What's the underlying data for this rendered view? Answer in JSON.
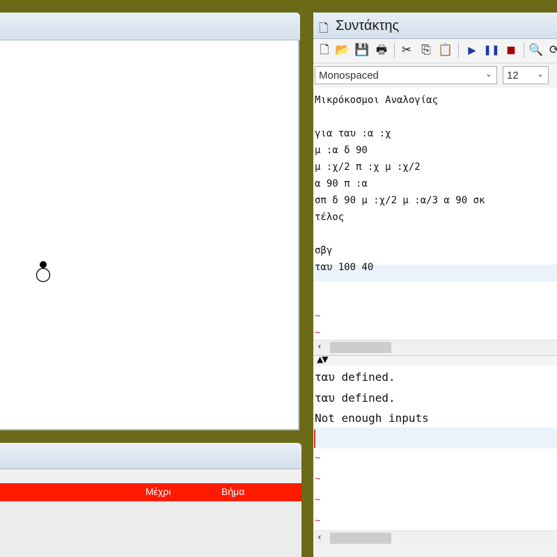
{
  "editor": {
    "title": "Συντάκτης",
    "font_select": {
      "value": "Monospaced"
    },
    "size_select": {
      "value": "12"
    },
    "code_lines": [
      "Μικρόκοσμοι Αναλογίας",
      "",
      "για ταυ :α :χ",
      "μ :α δ 90",
      "μ :χ/2 π :χ μ :χ/2",
      "α 90 π :α",
      "σπ δ 90 μ :χ/2 μ :α/3 α 90 σκ",
      "τέλος",
      "",
      "σβγ",
      "ταυ 100 40"
    ],
    "tilde": "~"
  },
  "console": {
    "lines": [
      "ταυ defined.",
      "ταυ defined.",
      "Not enough inputs"
    ]
  },
  "bottom_panel": {
    "columns": {
      "until": "Μέχρι",
      "step": "Βήμα"
    }
  },
  "colors": {
    "desktop": "#6b6a16",
    "header_red": "#ff1a00",
    "tilde_red": "#d0312d"
  },
  "icons": {
    "toolbar": [
      "new-file-icon",
      "open-folder-icon",
      "save-icon",
      "print-icon",
      "cut-icon",
      "copy-icon",
      "paste-icon",
      "run-icon",
      "pause-icon",
      "stop-icon",
      "find-icon"
    ]
  }
}
